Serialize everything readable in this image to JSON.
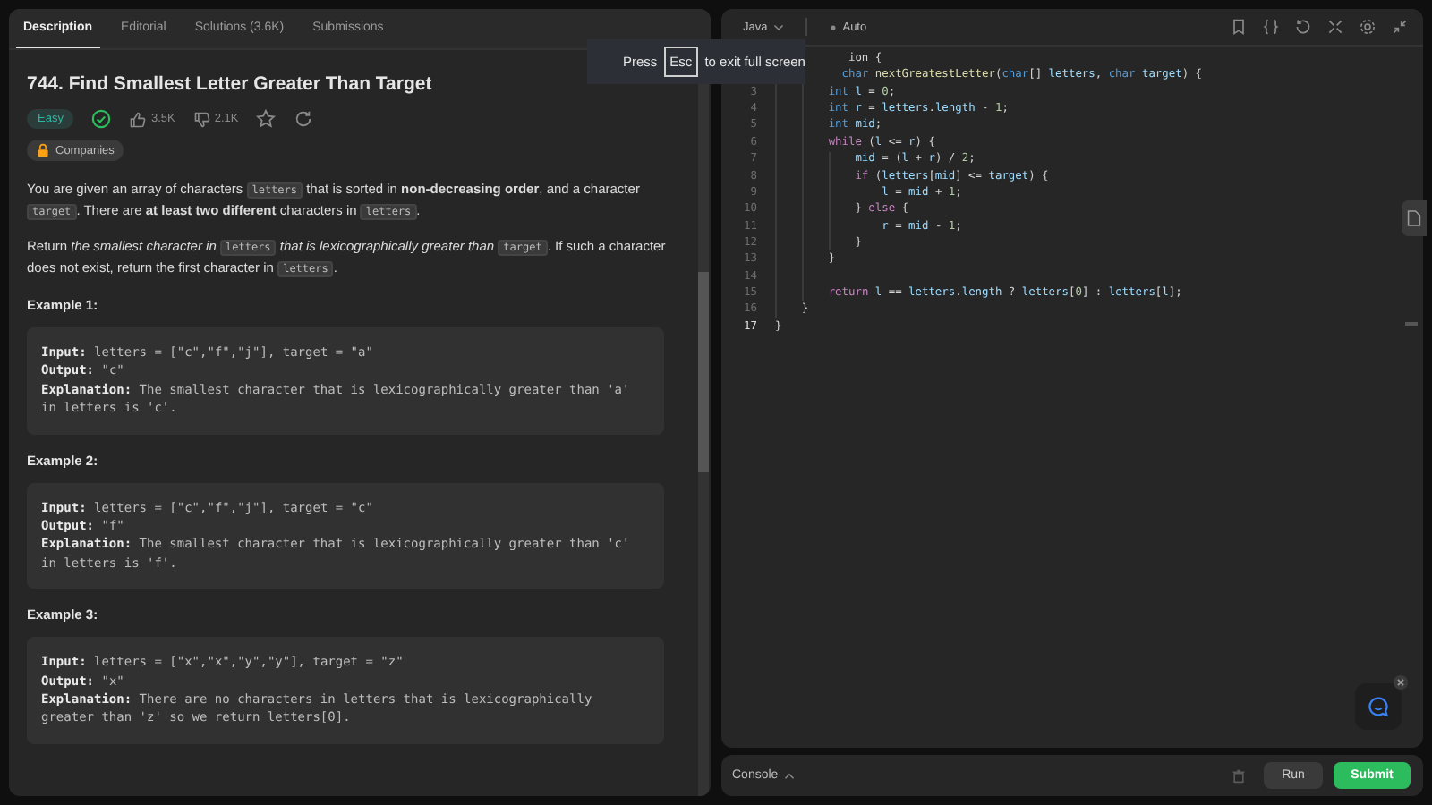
{
  "tabs": [
    {
      "label": "Description",
      "selected": true
    },
    {
      "label": "Editorial",
      "selected": false
    },
    {
      "label": "Solutions (3.6K)",
      "selected": false
    },
    {
      "label": "Submissions",
      "selected": false
    }
  ],
  "problem": {
    "title": "744. Find Smallest Letter Greater Than Target",
    "difficulty": "Easy",
    "solved": true,
    "likes": "3.5K",
    "dislikes": "2.1K",
    "companies": "Companies"
  },
  "paragraphs": [
    [
      {
        "kind": "text",
        "text": "You are given an array of characters "
      },
      {
        "kind": "code",
        "text": "letters"
      },
      {
        "kind": "text",
        "text": " that is sorted in **non-decreasing order**, and a character "
      },
      {
        "kind": "code",
        "text": "target"
      },
      {
        "kind": "text",
        "text": ". There are **at least two different** characters in "
      },
      {
        "kind": "code",
        "text": "letters"
      },
      {
        "kind": "text",
        "text": "."
      }
    ],
    [
      {
        "kind": "text",
        "text": "Return *the smallest character in* "
      },
      {
        "kind": "code",
        "text": "letters"
      },
      {
        "kind": "text",
        "text": " *that is lexicographically greater than* "
      },
      {
        "kind": "code",
        "text": "target"
      },
      {
        "kind": "text",
        "text": ". If such a character does not exist, return the first character in "
      },
      {
        "kind": "code",
        "text": "letters"
      },
      {
        "kind": "text",
        "text": "."
      }
    ]
  ],
  "examples": [
    {
      "title": "Example 1:",
      "lines": [
        {
          "label": "Input:",
          "value": "letters = [\"c\",\"f\",\"j\"], target = \"a\""
        },
        {
          "label": "Output:",
          "value": "\"c\""
        },
        {
          "label": "Explanation:",
          "value": "The smallest character that is lexicographically greater than 'a' in letters is 'c'."
        }
      ]
    },
    {
      "title": "Example 2:",
      "lines": [
        {
          "label": "Input:",
          "value": "letters = [\"c\",\"f\",\"j\"], target = \"c\""
        },
        {
          "label": "Output:",
          "value": "\"f\""
        },
        {
          "label": "Explanation:",
          "value": "The smallest character that is lexicographically greater than 'c' in letters is 'f'."
        }
      ]
    },
    {
      "title": "Example 3:",
      "lines": [
        {
          "label": "Input:",
          "value": "letters = [\"x\",\"x\",\"y\",\"y\"], target = \"z\""
        },
        {
          "label": "Output:",
          "value": "\"x\""
        },
        {
          "label": "Explanation:",
          "value": "There are no characters in letters that is lexicographically greater than 'z' so we return letters[0]."
        }
      ]
    }
  ],
  "editor": {
    "language": "Java",
    "mode": "Auto",
    "lines": [
      {
        "tokens": [
          {
            "kind": "plain",
            "text": "           ion {"
          }
        ]
      },
      {
        "tokens": [
          {
            "kind": "type",
            "text": "          char "
          },
          {
            "kind": "function",
            "text": "nextGreatestLetter"
          },
          {
            "kind": "plain",
            "text": "("
          },
          {
            "kind": "type",
            "text": "char"
          },
          {
            "kind": "plain",
            "text": "[] "
          },
          {
            "kind": "variable",
            "text": "letters"
          },
          {
            "kind": "plain",
            "text": ", "
          },
          {
            "kind": "type",
            "text": "char "
          },
          {
            "kind": "variable",
            "text": "target"
          },
          {
            "kind": "plain",
            "text": ") {"
          }
        ]
      },
      {
        "number": "3",
        "tokens": [
          {
            "kind": "type",
            "text": "        int "
          },
          {
            "kind": "variable",
            "text": "l"
          },
          {
            "kind": "plain",
            "text": " = "
          },
          {
            "kind": "number",
            "text": "0"
          },
          {
            "kind": "plain",
            "text": ";"
          }
        ]
      },
      {
        "number": "4",
        "tokens": [
          {
            "kind": "type",
            "text": "        int "
          },
          {
            "kind": "variable",
            "text": "r"
          },
          {
            "kind": "plain",
            "text": " = "
          },
          {
            "kind": "variable",
            "text": "letters"
          },
          {
            "kind": "plain",
            "text": "."
          },
          {
            "kind": "variable",
            "text": "length"
          },
          {
            "kind": "plain",
            "text": " - "
          },
          {
            "kind": "number",
            "text": "1"
          },
          {
            "kind": "plain",
            "text": ";"
          }
        ]
      },
      {
        "number": "5",
        "tokens": [
          {
            "kind": "type",
            "text": "        int "
          },
          {
            "kind": "variable",
            "text": "mid"
          },
          {
            "kind": "plain",
            "text": ";"
          }
        ]
      },
      {
        "number": "6",
        "tokens": [
          {
            "kind": "control",
            "text": "        while"
          },
          {
            "kind": "plain",
            "text": " ("
          },
          {
            "kind": "variable",
            "text": "l"
          },
          {
            "kind": "plain",
            "text": " <= "
          },
          {
            "kind": "variable",
            "text": "r"
          },
          {
            "kind": "plain",
            "text": ") {"
          }
        ]
      },
      {
        "number": "7",
        "tokens": [
          {
            "kind": "variable",
            "text": "            mid"
          },
          {
            "kind": "plain",
            "text": " = ("
          },
          {
            "kind": "variable",
            "text": "l"
          },
          {
            "kind": "plain",
            "text": " + "
          },
          {
            "kind": "variable",
            "text": "r"
          },
          {
            "kind": "plain",
            "text": ") / "
          },
          {
            "kind": "number",
            "text": "2"
          },
          {
            "kind": "plain",
            "text": ";"
          }
        ]
      },
      {
        "number": "8",
        "tokens": [
          {
            "kind": "control",
            "text": "            if"
          },
          {
            "kind": "plain",
            "text": " ("
          },
          {
            "kind": "variable",
            "text": "letters"
          },
          {
            "kind": "plain",
            "text": "["
          },
          {
            "kind": "variable",
            "text": "mid"
          },
          {
            "kind": "plain",
            "text": "] <= "
          },
          {
            "kind": "variable",
            "text": "target"
          },
          {
            "kind": "plain",
            "text": ") {"
          }
        ]
      },
      {
        "number": "9",
        "tokens": [
          {
            "kind": "variable",
            "text": "                l"
          },
          {
            "kind": "plain",
            "text": " = "
          },
          {
            "kind": "variable",
            "text": "mid"
          },
          {
            "kind": "plain",
            "text": " + "
          },
          {
            "kind": "number",
            "text": "1"
          },
          {
            "kind": "plain",
            "text": ";"
          }
        ]
      },
      {
        "number": "10",
        "tokens": [
          {
            "kind": "plain",
            "text": "            } "
          },
          {
            "kind": "control",
            "text": "else"
          },
          {
            "kind": "plain",
            "text": " {"
          }
        ]
      },
      {
        "number": "11",
        "tokens": [
          {
            "kind": "variable",
            "text": "                r"
          },
          {
            "kind": "plain",
            "text": " = "
          },
          {
            "kind": "variable",
            "text": "mid"
          },
          {
            "kind": "plain",
            "text": " - "
          },
          {
            "kind": "number",
            "text": "1"
          },
          {
            "kind": "plain",
            "text": ";"
          }
        ]
      },
      {
        "number": "12",
        "tokens": [
          {
            "kind": "plain",
            "text": "            }"
          }
        ]
      },
      {
        "number": "13",
        "tokens": [
          {
            "kind": "plain",
            "text": "        }"
          }
        ]
      },
      {
        "number": "14"
      },
      {
        "number": "15",
        "tokens": [
          {
            "kind": "control",
            "text": "        return "
          },
          {
            "kind": "variable",
            "text": "l"
          },
          {
            "kind": "plain",
            "text": " == "
          },
          {
            "kind": "variable",
            "text": "letters"
          },
          {
            "kind": "plain",
            "text": "."
          },
          {
            "kind": "variable",
            "text": "length"
          },
          {
            "kind": "plain",
            "text": " ? "
          },
          {
            "kind": "variable",
            "text": "letters"
          },
          {
            "kind": "plain",
            "text": "["
          },
          {
            "kind": "number",
            "text": "0"
          },
          {
            "kind": "plain",
            "text": "] : "
          },
          {
            "kind": "variable",
            "text": "letters"
          },
          {
            "kind": "plain",
            "text": "["
          },
          {
            "kind": "variable",
            "text": "l"
          },
          {
            "kind": "plain",
            "text": "];"
          }
        ]
      },
      {
        "number": "16",
        "tokens": [
          {
            "kind": "plain",
            "text": "    }"
          }
        ]
      },
      {
        "number": "17",
        "current": true,
        "tokens": [
          {
            "kind": "plain",
            "text": "}"
          }
        ]
      }
    ]
  },
  "fullscreen_hint": {
    "before": "Press",
    "key": "Esc",
    "after": "to exit full screen"
  },
  "console": {
    "label": "Console",
    "run": "Run",
    "submit": "Submit"
  }
}
